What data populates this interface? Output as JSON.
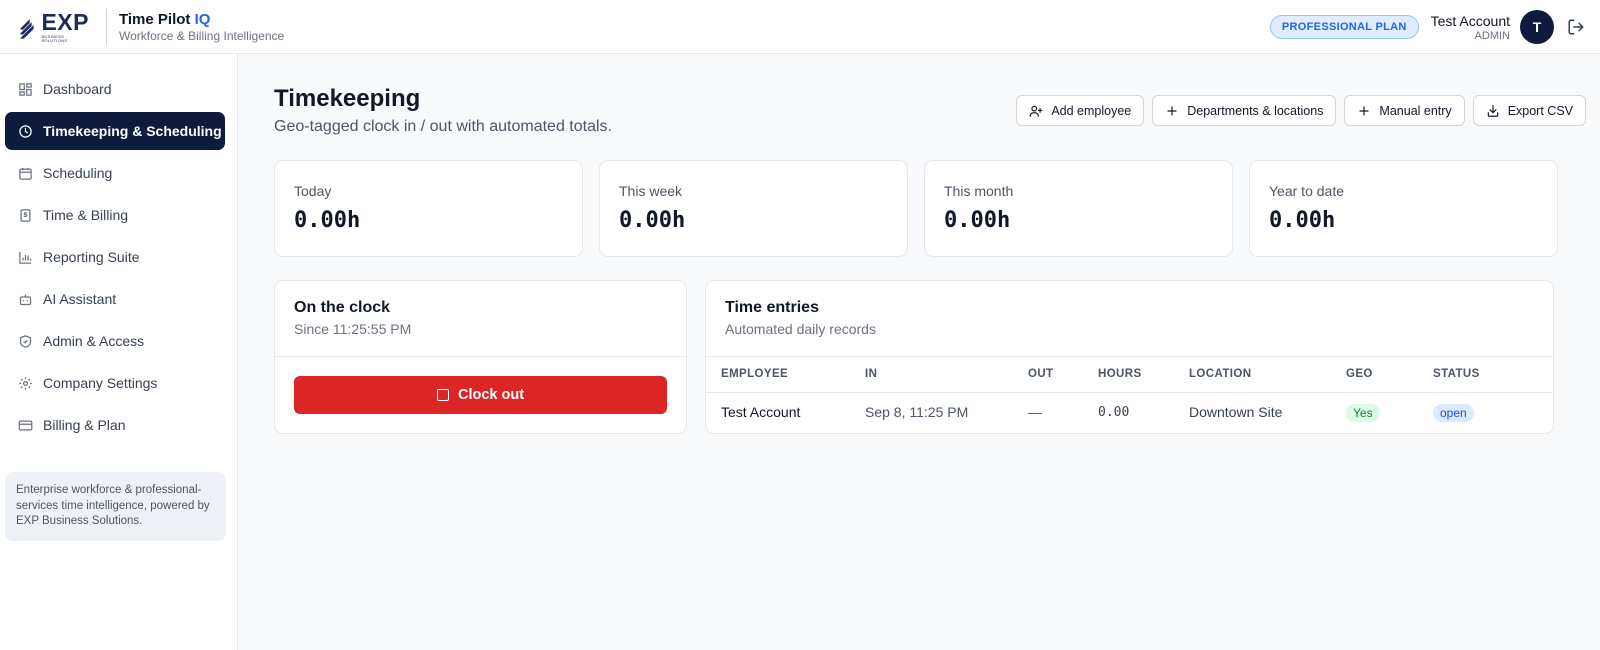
{
  "header": {
    "logo_text": "EXP",
    "logo_subtext": "BUSINESS SOLUTIONS",
    "app_name": "Time Pilot",
    "app_name_suffix": "IQ",
    "tagline": "Workforce & Billing Intelligence",
    "plan_badge": "PROFESSIONAL PLAN",
    "user_name": "Test Account",
    "user_role": "ADMIN",
    "avatar_initial": "T"
  },
  "sidebar": {
    "items": [
      {
        "label": "Dashboard",
        "icon": "grid-icon"
      },
      {
        "label": "Timekeeping & Scheduling",
        "icon": "clock-icon",
        "active": true
      },
      {
        "label": "Scheduling",
        "icon": "calendar-icon"
      },
      {
        "label": "Time & Billing",
        "icon": "dollar-doc-icon"
      },
      {
        "label": "Reporting Suite",
        "icon": "bar-chart-icon"
      },
      {
        "label": "AI Assistant",
        "icon": "bot-icon"
      },
      {
        "label": "Admin & Access",
        "icon": "shield-icon"
      },
      {
        "label": "Company Settings",
        "icon": "gear-icon"
      },
      {
        "label": "Billing & Plan",
        "icon": "credit-card-icon"
      }
    ],
    "note": "Enterprise workforce & professional-services time intelligence, powered by EXP Business Solutions."
  },
  "main": {
    "title": "Timekeeping",
    "subtitle": "Geo-tagged clock in / out with automated totals.",
    "actions": [
      {
        "label": "Add employee",
        "icon": "user-plus-icon"
      },
      {
        "label": "Departments & locations",
        "icon": "plus-icon"
      },
      {
        "label": "Manual entry",
        "icon": "plus-icon"
      },
      {
        "label": "Export CSV",
        "icon": "download-icon"
      }
    ],
    "stats": [
      {
        "label": "Today",
        "value": "0.00h"
      },
      {
        "label": "This week",
        "value": "0.00h"
      },
      {
        "label": "This month",
        "value": "0.00h"
      },
      {
        "label": "Year to date",
        "value": "0.00h"
      }
    ],
    "clock": {
      "title": "On the clock",
      "since": "Since 11:25:55 PM",
      "button": "Clock out"
    },
    "entries": {
      "title": "Time entries",
      "subtitle": "Automated daily records",
      "columns": [
        "EMPLOYEE",
        "IN",
        "OUT",
        "HOURS",
        "LOCATION",
        "GEO",
        "STATUS"
      ],
      "rows": [
        {
          "employee": "Test Account",
          "in": "Sep 8, 11:25 PM",
          "out": "—",
          "hours": "0.00",
          "location": "Downtown Site",
          "geo": "Yes",
          "status": "open"
        }
      ]
    }
  },
  "colors": {
    "navy": "#0f1b3d",
    "accent_blue": "#2563eb",
    "danger_red": "#dc2626",
    "geo_green": "#15803d",
    "status_blue": "#1d4ed8"
  }
}
